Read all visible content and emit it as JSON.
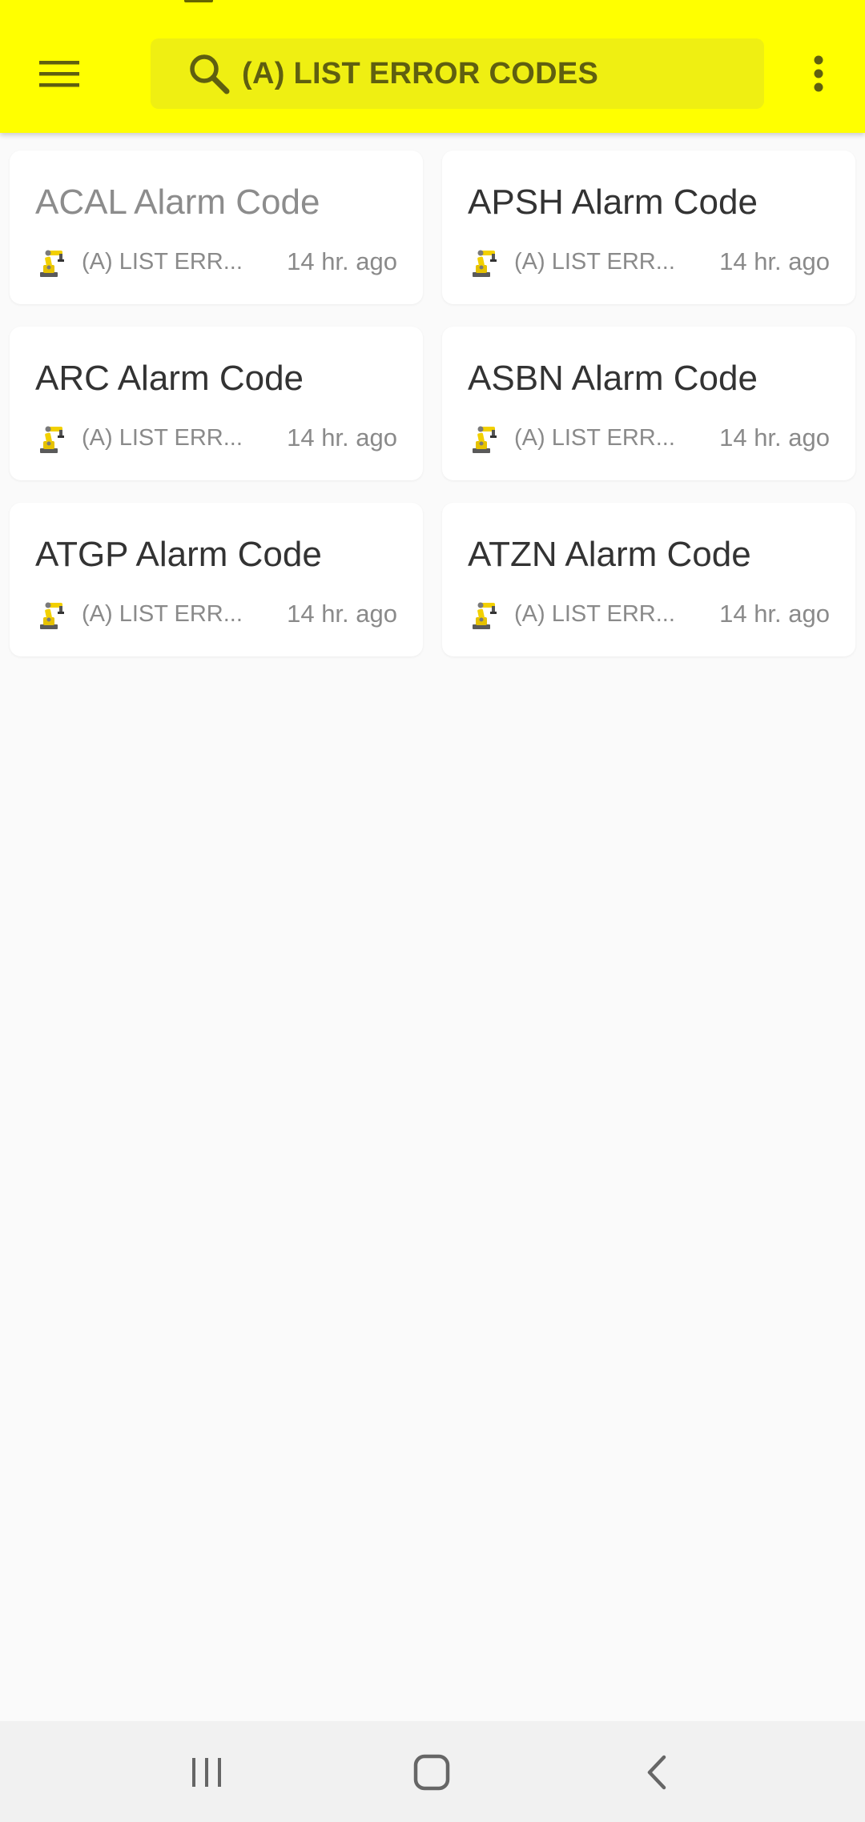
{
  "app_bar": {
    "menu_icon": "hamburger-menu-icon",
    "search": {
      "icon": "search-icon",
      "query": "(A) LIST ERROR CODES"
    },
    "overflow_icon": "more-vert-icon",
    "background_color": "#ffff00",
    "search_background_color": "#efef12"
  },
  "cards": [
    {
      "title": "ACAL Alarm Code",
      "source": "(A) LIST ERR...",
      "time": "14 hr. ago",
      "visited": true
    },
    {
      "title": "APSH Alarm Code",
      "source": "(A) LIST ERR...",
      "time": "14 hr. ago",
      "visited": false
    },
    {
      "title": "ARC Alarm Code",
      "source": "(A) LIST ERR...",
      "time": "14 hr. ago",
      "visited": false
    },
    {
      "title": "ASBN Alarm Code",
      "source": "(A) LIST ERR...",
      "time": "14 hr. ago",
      "visited": false
    },
    {
      "title": "ATGP Alarm Code",
      "source": "(A) LIST ERR...",
      "time": "14 hr. ago",
      "visited": false
    },
    {
      "title": "ATZN Alarm Code",
      "source": "(A) LIST ERR...",
      "time": "14 hr. ago",
      "visited": false
    }
  ],
  "card_source_icon": "industrial-robot-icon",
  "system_nav": {
    "recents_icon": "recents-icon",
    "home_icon": "home-icon",
    "back_icon": "back-icon"
  }
}
